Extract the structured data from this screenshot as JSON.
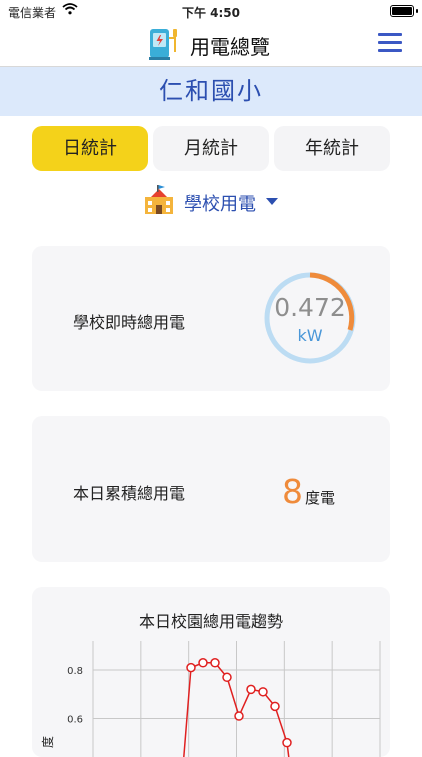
{
  "status_bar": {
    "carrier": "電信業者",
    "time": "下午 4:50"
  },
  "header": {
    "title": "用電總覽",
    "logo_icon": "ev-charger-icon",
    "menu_icon": "hamburger-menu-icon"
  },
  "school_name": "仁和國小",
  "tabs": [
    {
      "label": "日統計",
      "active": true
    },
    {
      "label": "月統計",
      "active": false
    },
    {
      "label": "年統計",
      "active": false
    }
  ],
  "usage_type": {
    "icon": "school-building-icon",
    "label": "學校用電"
  },
  "realtime": {
    "label": "學校即時總用電",
    "value": "0.472",
    "unit": "kW"
  },
  "daily_total": {
    "label": "本日累積總用電",
    "value": "8",
    "unit": "度電"
  },
  "colors": {
    "accent_blue": "#2c4fb0",
    "tab_active": "#f4d21a",
    "gauge_orange": "#ef8b3b",
    "gauge_blue": "#bcdcf3",
    "line_red": "#e02020"
  },
  "chart_data": {
    "type": "line",
    "title": "本日校園總用電趨勢",
    "ylabel": "度",
    "y_ticks": [
      "0.8",
      "0.6"
    ],
    "ylim": [
      0.42,
      0.92
    ],
    "grid": true,
    "series": [
      {
        "values": [
          0.81,
          0.83,
          0.83,
          0.77,
          0.61,
          0.72,
          0.71,
          0.65,
          0.5
        ]
      }
    ]
  }
}
